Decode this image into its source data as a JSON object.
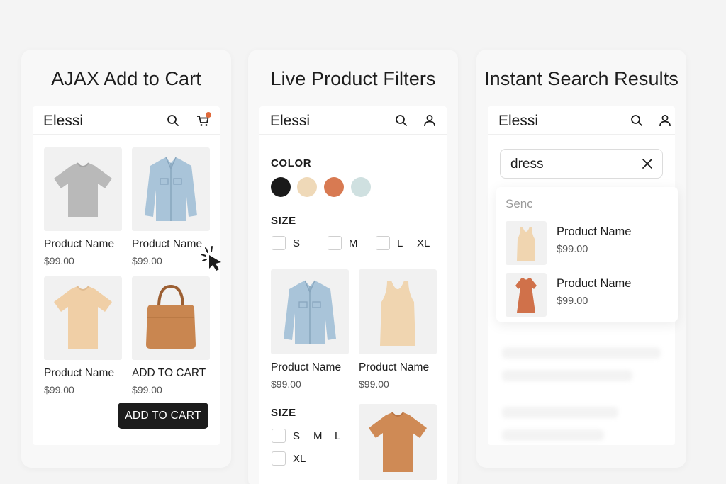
{
  "panels": {
    "ajax": {
      "title": "AJAX Add to Cart",
      "brand": "Elessi",
      "products": [
        {
          "name": "Product Name",
          "price": "$99.00"
        },
        {
          "name": "Product Name",
          "price": "$99.00"
        },
        {
          "name": "Product Name",
          "price": "$99.00"
        },
        {
          "name": "ADD TO CART",
          "price": "$99.00"
        }
      ],
      "button_label": "ADD TO CART"
    },
    "filters": {
      "title": "Live Product Filters",
      "brand": "Elessi",
      "color_label": "COLOR",
      "colors": [
        "#1a1a1a",
        "#efd9b8",
        "#d87a52",
        "#cfe0e0"
      ],
      "size_label": "SIZE",
      "sizes": [
        "S",
        "M",
        "L",
        "XL"
      ],
      "products": [
        {
          "name": "Product Name",
          "price": "$99.00"
        },
        {
          "name": "Product Name",
          "price": "$99.00"
        }
      ],
      "size_label_2": "SIZE",
      "sizes_2": [
        "S",
        "M",
        "L",
        "XL"
      ]
    },
    "search": {
      "title": "Instant Search Results",
      "brand": "Elessi",
      "query": "dress",
      "dropdown_label": "Senc",
      "results": [
        {
          "name": "Product Name",
          "price": "$99.00"
        },
        {
          "name": "Product Name",
          "price": "$99.00"
        }
      ]
    }
  },
  "icons": {
    "search": "search-icon",
    "cart": "cart-icon",
    "user": "user-icon",
    "clear": "close-icon",
    "pointer": "cursor-icon"
  },
  "colors": {
    "accent": "#e06a3b",
    "button": "#1c1c1c"
  }
}
